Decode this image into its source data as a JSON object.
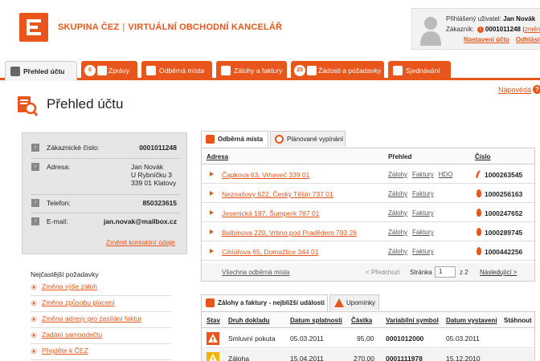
{
  "header": {
    "brand_left": "SKUPINA ČEZ",
    "brand_sep": "|",
    "brand_right": "VIRTUÁLNÍ OBCHODNÍ KANCELÁŘ",
    "user": {
      "logged_label": "Přihlášený uživatel:",
      "logged_name": "Jan Novák",
      "customer_label": "Zákazník:",
      "customer_number": "0001011248",
      "change_link": "změnit",
      "settings_link": "Nastavení účtu",
      "logout_link": "Odhlásit"
    }
  },
  "nav": {
    "tabs": [
      {
        "label": "Přehled účtu",
        "active": true
      },
      {
        "label": "Zprávy",
        "badge": "0"
      },
      {
        "label": "Odběrná místa"
      },
      {
        "label": "Zálohy a faktury"
      },
      {
        "label": "Žádosti a požadavky",
        "badge": "25"
      },
      {
        "label": "Sjednávání"
      }
    ]
  },
  "page": {
    "title": "Přehled účtu",
    "help": "Nápověda",
    "help_icon": "?"
  },
  "customer": {
    "rows": [
      {
        "label": "Zákaznické číslo:",
        "value": "0001011248"
      },
      {
        "label": "Adresa:",
        "value_lines": [
          "Jan Novák",
          "U Rybníčku 3",
          "339 01 Klatovy"
        ]
      },
      {
        "label": "Telefon:",
        "value": "850323615"
      },
      {
        "label": "E-mail:",
        "value": "jan.novak@mailbox.cz"
      }
    ],
    "change_contact": "Změnit kontaktní údaje"
  },
  "frequent": {
    "title": "Nejčastější požadavky",
    "items": [
      "Změna výše záloh",
      "Změna způsobu placení",
      "Změna adresy pro zasílání faktur",
      "Zadání samoodečtu",
      "Přejděte k ČEZ"
    ]
  },
  "places_panel": {
    "tabs": [
      "Odběrná místa",
      "Plánované vypínání"
    ],
    "headers": {
      "address": "Adresa",
      "overview": "Přehled",
      "number": "Číslo"
    },
    "rows": [
      {
        "address": "Čapkova 63, Vrhaveč 339 01",
        "links": [
          "Zálohy",
          "Faktury",
          "HDO"
        ],
        "number": "1000263545"
      },
      {
        "address": "Neznašovy 622, Český Těšín 737 01",
        "links": [
          "Zálohy",
          "Faktury"
        ],
        "number": "1000256163"
      },
      {
        "address": "Jesenická 187, Šumperk 787 01",
        "links": [
          "Zálohy",
          "Faktury"
        ],
        "number": "1000247652"
      },
      {
        "address": "Balbínova 220, Vrbno pod Pradědem 793 26",
        "links": [
          "Zálohy",
          "Faktury"
        ],
        "number": "1000289745"
      },
      {
        "address": "Cihlářova 65, Domažlice 344 01",
        "links": [
          "Zálohy",
          "Faktury"
        ],
        "number": "1000442256"
      }
    ],
    "footer": {
      "all_link": "Všechna odběrná místa",
      "prev": "< Předchozí",
      "page_label": "Stránka",
      "page_value": "1",
      "of": "z 2",
      "next": "Následující >"
    }
  },
  "docs_panel": {
    "tabs": [
      "Zálohy a faktury - nejbližší události",
      "Upomínky"
    ],
    "headers": {
      "status": "Stav",
      "type": "Druh dokladu",
      "due": "Datum splatnosti",
      "amount": "Částka",
      "vs": "Variabilní symbol",
      "issued": "Datum vystavení",
      "download": "Stáhnout"
    },
    "rows": [
      {
        "type": "Smluvní pokuta",
        "due": "05.03.2011",
        "amount": "95,00",
        "vs": "0001012000",
        "issued": "05.03.2011",
        "status_color": "#e8561b"
      },
      {
        "type": "Záloha",
        "due": "15.04.2011",
        "amount": "270,00",
        "vs": "0001111978",
        "issued": "15.12.2010",
        "status_color": "#f0b400"
      }
    ]
  },
  "colors": {
    "accent": "#e8561b"
  }
}
